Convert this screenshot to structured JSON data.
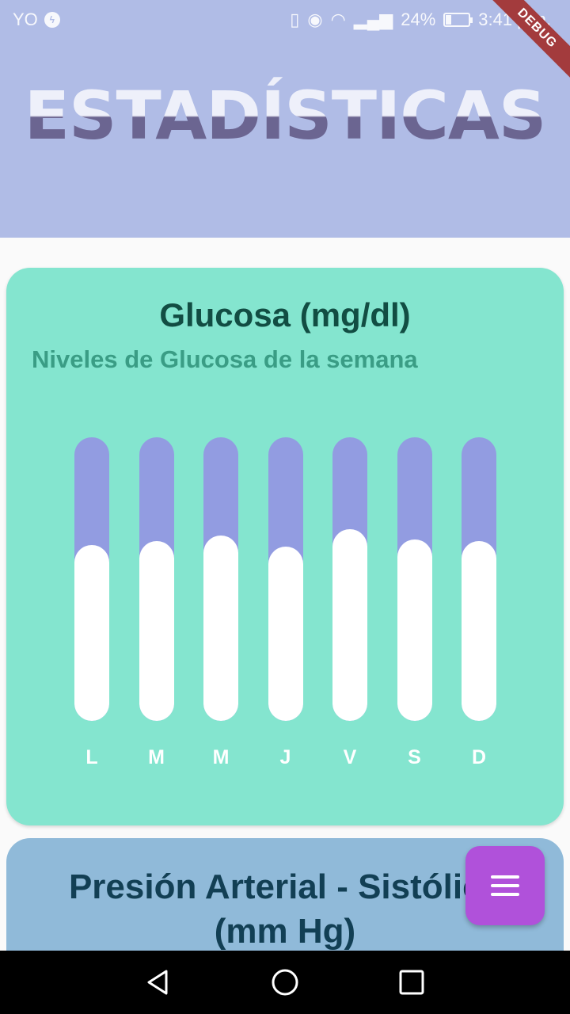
{
  "status_bar": {
    "carrier": "YO",
    "battery_text": "24%",
    "time": "3:41 p.m."
  },
  "debug_banner": "DEBUG",
  "header": {
    "title": "ESTADÍSTICAS"
  },
  "glucose_card": {
    "title": "Glucosa (mg/dl)",
    "subtitle": "Niveles de Glucosa de la semana"
  },
  "chart_data": {
    "type": "bar",
    "title": "Glucosa (mg/dl)",
    "subtitle": "Niveles de Glucosa de la semana",
    "categories": [
      "L",
      "M",
      "M",
      "J",
      "V",
      "S",
      "D"
    ],
    "values": [
      0.62,
      0.635,
      0.655,
      0.615,
      0.675,
      0.64,
      0.635
    ],
    "ylim": [
      0,
      1
    ],
    "grid": false,
    "colors": {
      "track": "#929ce1",
      "fill": "#ffffff",
      "background": "#84e5cf"
    }
  },
  "pressure_card": {
    "title": "Presión Arterial - Sistólica (mm Hg)"
  },
  "colors": {
    "header_bg": "#b0bce6",
    "fab": "#b051da",
    "pressure_bg": "#90bad9"
  }
}
